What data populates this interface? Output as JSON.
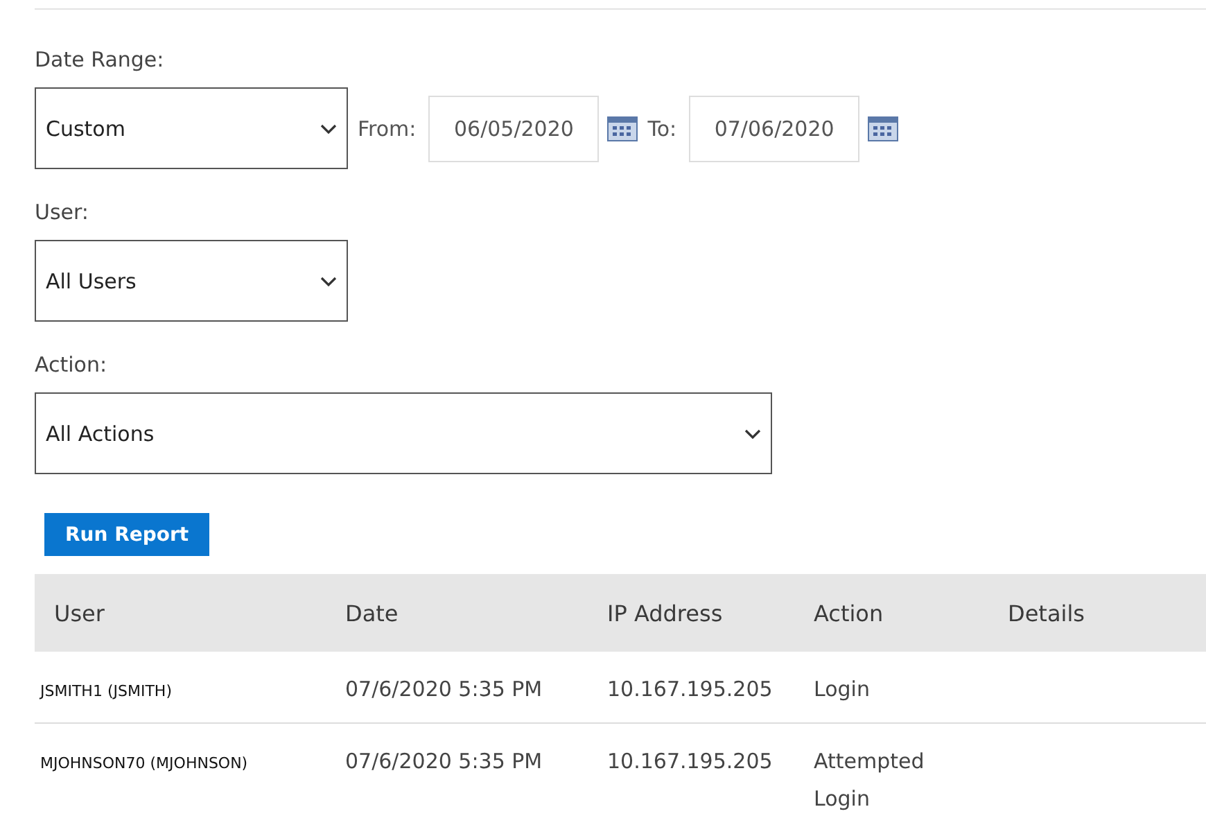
{
  "filters": {
    "date_range": {
      "label": "Date Range:",
      "value": "Custom",
      "from_label": "From:",
      "from": "06/05/2020",
      "to_label": "To:",
      "to": "07/06/2020"
    },
    "user": {
      "label": "User:",
      "value": "All Users"
    },
    "action": {
      "label": "Action:",
      "value": "All Actions"
    }
  },
  "run_button": "Run Report",
  "table": {
    "columns": [
      "User",
      "Date",
      "IP Address",
      "Action",
      "Details"
    ],
    "rows": [
      {
        "user": "JSMITH1 (JSMITH)",
        "date": "07/6/2020 5:35 PM",
        "ip": "10.167.195.205",
        "action": "Login"
      },
      {
        "user": "MJOHNSON70 (MJOHNSON)",
        "date": "07/6/2020 5:35 PM",
        "ip": "10.167.195.205",
        "action": "Attempted Login"
      }
    ]
  }
}
